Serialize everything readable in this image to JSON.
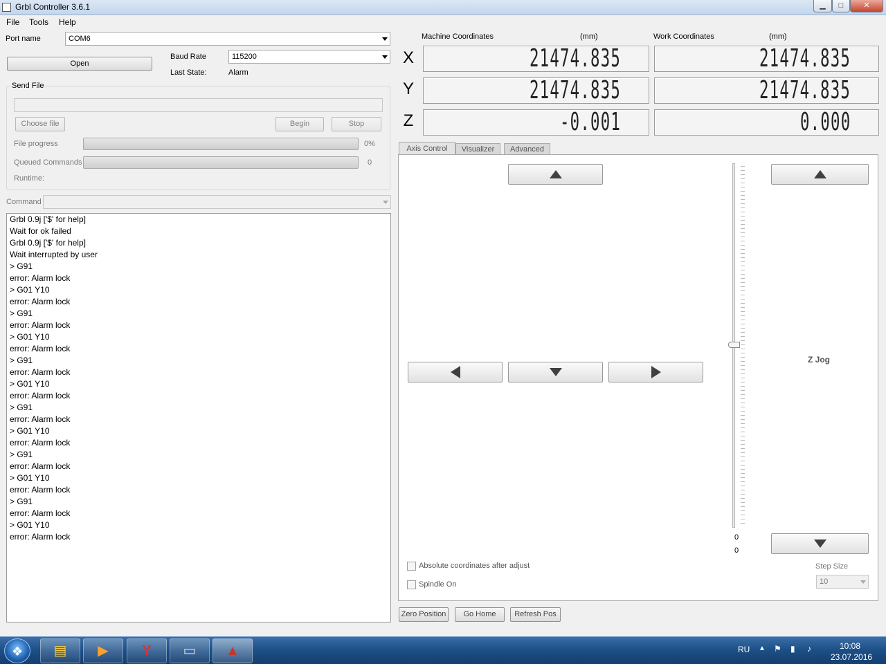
{
  "window": {
    "title": "Grbl Controller 3.6.1",
    "min": "▁",
    "max": "□",
    "close": "✕"
  },
  "menu": [
    "File",
    "Tools",
    "Help"
  ],
  "connection": {
    "port_label": "Port name",
    "port_value": "COM6",
    "open_button": "Open",
    "baud_label": "Baud Rate",
    "baud_value": "115200",
    "last_state_label": "Last State:",
    "last_state_value": "Alarm"
  },
  "send_file": {
    "group_label": "Send File",
    "choose_button": "Choose file",
    "begin_button": "Begin",
    "stop_button": "Stop",
    "file_progress_label": "File progress",
    "file_progress_value": "0%",
    "file_progress": 0,
    "queued_label": "Queued Commands",
    "queued_value": "0",
    "queued_progress": 0,
    "runtime_label": "Runtime:"
  },
  "command": {
    "label": "Command",
    "value": ""
  },
  "console_lines": [
    "Grbl 0.9j ['$' for help]",
    "Wait for ok failed",
    "Grbl 0.9j ['$' for help]",
    "Wait interrupted by user",
    "> G91",
    "error: Alarm lock",
    "> G01 Y10",
    "error: Alarm lock",
    "> G91",
    "error: Alarm lock",
    "> G01 Y10",
    "error: Alarm lock",
    "> G91",
    "error: Alarm lock",
    "> G01 Y10",
    "error: Alarm lock",
    "> G91",
    "error: Alarm lock",
    "> G01 Y10",
    "error: Alarm lock",
    "> G91",
    "error: Alarm lock",
    "> G01 Y10",
    "error: Alarm lock",
    "> G91",
    "error: Alarm lock",
    "> G01 Y10",
    "error: Alarm lock"
  ],
  "coords": {
    "machine_label": "Machine Coordinates",
    "machine_unit": "(mm)",
    "work_label": "Work Coordinates",
    "work_unit": "(mm)",
    "axes": [
      {
        "axis": "X",
        "machine": "21474.835",
        "work": "21474.835"
      },
      {
        "axis": "Y",
        "machine": "21474.835",
        "work": "21474.835"
      },
      {
        "axis": "Z",
        "machine": "-0.001",
        "work": "0.000"
      }
    ]
  },
  "tabs": [
    {
      "label": "Axis Control",
      "active": true
    },
    {
      "label": "Visualizer",
      "active": false
    },
    {
      "label": "Advanced",
      "active": false
    }
  ],
  "axis_control": {
    "z_jog_label": "Z Jog",
    "slider_value_1": "0",
    "slider_value_2": "0",
    "absolute_checkbox_label": "Absolute coordinates after adjust",
    "absolute_checked": false,
    "spindle_checkbox_label": "Spindle On",
    "spindle_checked": false,
    "step_size_label": "Step Size",
    "step_size_value": "10"
  },
  "bottom_buttons": {
    "zero": "Zero Position",
    "home": "Go Home",
    "refresh": "Refresh Pos"
  },
  "taskbar": {
    "lang": "RU",
    "time": "10:08",
    "date": "23.07.2016"
  }
}
